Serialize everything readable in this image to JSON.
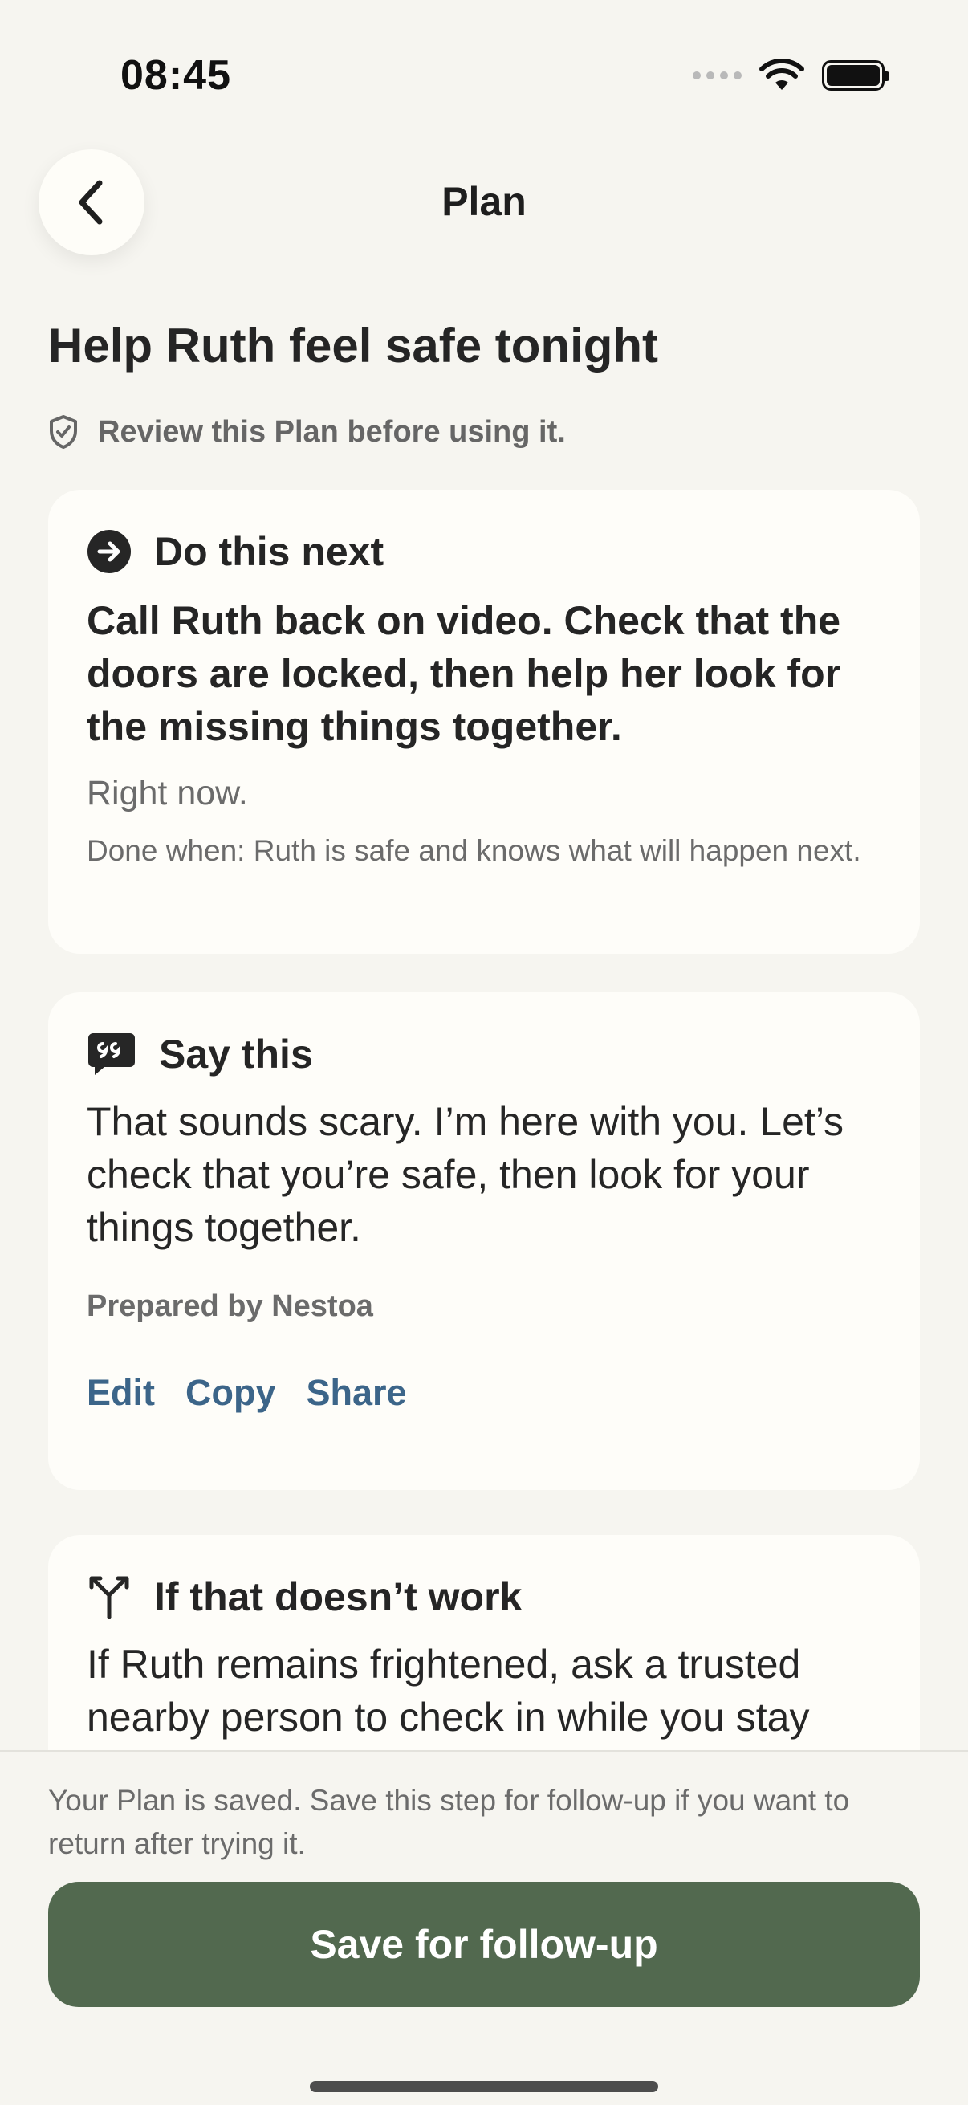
{
  "status_bar": {
    "time": "08:45"
  },
  "nav": {
    "title": "Plan"
  },
  "page": {
    "heading": "Help Ruth feel safe tonight",
    "review_note": "Review this Plan before using it."
  },
  "cards": {
    "next": {
      "label": "Do this next",
      "instruction": "Call Ruth back on video. Check that the doors are locked, then help her look for the missing things together.",
      "timing": "Right now.",
      "done_when": "Done when: Ruth is safe and knows what will happen next."
    },
    "say": {
      "label": "Say this",
      "text": "That sounds scary. I’m here with you. Let’s check that you’re safe, then look for your things together.",
      "prepared_by": "Prepared by Nestoa",
      "actions": {
        "edit": "Edit",
        "copy": "Copy",
        "share": "Share"
      }
    },
    "fallback": {
      "label": "If that doesn’t work",
      "text": "If Ruth remains frightened, ask a trusted nearby person to check in while you stay"
    }
  },
  "footer": {
    "save_note": "Your Plan is saved. Save this step for follow-up if you want to return after trying it.",
    "save_button": "Save for follow-up"
  },
  "colors": {
    "background": "#f6f5f0",
    "card": "#fefdf9",
    "primary_button": "#52694f",
    "link": "#3c6589"
  },
  "icons": {
    "back": "chevron-left-icon",
    "review": "shield-check-icon",
    "next": "arrow-right-circle-icon",
    "say": "quote-bubble-icon",
    "fallback": "branch-icon"
  }
}
